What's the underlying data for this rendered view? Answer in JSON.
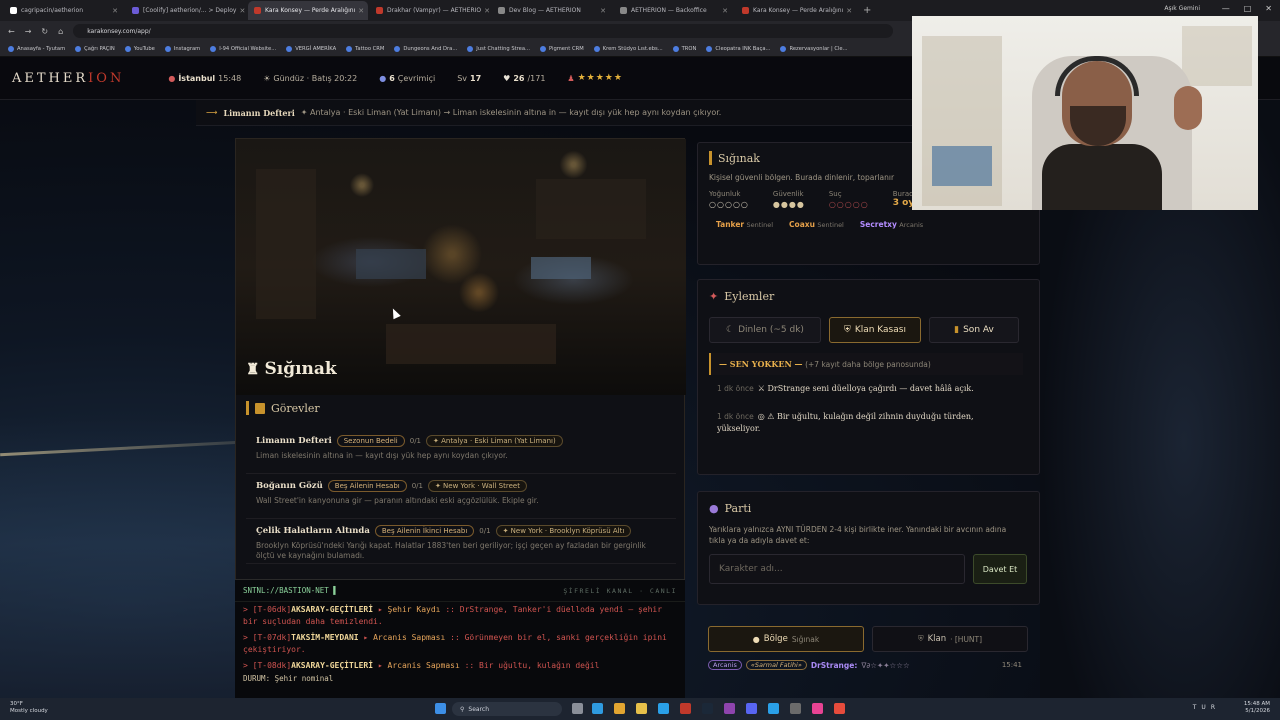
{
  "browser": {
    "tabs": [
      {
        "label": "cagripacin/aetherion",
        "color": "#ffffff",
        "active": false
      },
      {
        "label": "[Coolify] aetherion/... > Deploy",
        "color": "#6b5bd6",
        "active": false
      },
      {
        "label": "Kara Konsey — Perde Aralığını",
        "color": "#c0392b",
        "active": true
      },
      {
        "label": "Drakhar (Vampyr) — AETHERIO",
        "color": "#c0392b",
        "active": false
      },
      {
        "label": "Dev Blog — AETHERION",
        "color": "#888888",
        "active": false
      },
      {
        "label": "AETHERION — Backoffice",
        "color": "#888888",
        "active": false
      },
      {
        "label": "Kara Konsey — Perde Aralığını",
        "color": "#c0392b",
        "active": false
      }
    ],
    "profile": "Aşık Gemini",
    "url": "karakonsey.com/app/",
    "bookmarks": [
      "Anasayfa - Tyutam",
      "Çağrı PAÇIN",
      "YouTube",
      "Instagram",
      "I-94 Official Website...",
      "VERGİ AMERİKA",
      "Tattoo CRM",
      "Dungeons And Dra...",
      "Just Chatting Strea...",
      "Pigment CRM",
      "Krem Stüdyo Lıst.ebs...",
      "TRON",
      "Cleopatra INK Baça...",
      "Rezervasyonlar | Cle..."
    ]
  },
  "nav": {
    "logo_a": "AETHER",
    "logo_b": "ION",
    "city": "İstanbul",
    "time": "15:48",
    "daytime": "Gündüz · Batış 20:22",
    "online_count": "6",
    "online_label": "Çevrimiçi",
    "level_label": "Sv",
    "level": "17",
    "hp": "26",
    "hp_max": "/171",
    "stars": "★★★★★"
  },
  "questbar": {
    "title": "Limanın Defteri",
    "text": "✦ Antalya · Eski Liman (Yat Limanı) → Liman iskelesinin altına in — kayıt dışı yük hep aynı koydan çıkıyor."
  },
  "scene": {
    "title": "Sığınak"
  },
  "quests": {
    "title": "Görevler",
    "items": [
      {
        "name": "Limanın Defteri",
        "pill": "Sezonun Bedeli",
        "count": "0/1",
        "loc": "✦ Antalya · Eski Liman (Yat Limanı)",
        "desc": "Liman iskelesinin altına in — kayıt dışı yük hep aynı koydan çıkıyor."
      },
      {
        "name": "Boğanın Gözü",
        "pill": "Beş Ailenin Hesabı",
        "count": "0/1",
        "loc": "✦ New York · Wall Street",
        "desc": "Wall Street'in kanyonuna gir — paranın altındaki eski açgözlülük. Ekiple gir."
      },
      {
        "name": "Çelik Halatların Altında",
        "pill": "Beş Ailenin İkinci Hesabı",
        "count": "0/1",
        "loc": "✦ New York · Brooklyn Köprüsü Altı",
        "desc": "Brooklyn Köprüsü'ndeki Yarığı kapat. Halatlar 1883'ten beri geriliyor; işçi geçen ay fazladan bir gerginlik ölçtü ve kaynağını bulamadı."
      }
    ]
  },
  "terminal": {
    "title": "SNTNL://BASTION-NET ▌",
    "tag": "ŞİFRELİ KANAL · CANLI",
    "lines": [
      {
        "time": "> [T-06dk]",
        "place": "AKSARAY-GEÇİTLERİ",
        "arrow": " ▸ ",
        "kind": "Şehir Kaydı",
        "text": " :: DrStrange, Tanker'i düelloda yendi — şehir bir suçludan daha temizlendi."
      },
      {
        "time": "> [T-07dk]",
        "place": "TAKSİM-MEYDANI",
        "arrow": " ▸ ",
        "kind": "Arcanis Sapması",
        "text": " :: Görünmeyen bir el, sanki gerçekliğin ipini çekiştiriyor."
      },
      {
        "time": "> [T-08dk]",
        "place": "AKSARAY-GEÇİTLERİ",
        "arrow": " ▸ ",
        "kind": "Arcanis Sapması",
        "text": " :: Bir uğultu, kulağın değil"
      }
    ],
    "status": "DURUM: Şehir nominal"
  },
  "sanctuary": {
    "title": "Sığınak",
    "desc": "Kişisel güvenli bölgen. Burada dinlenir, toparlanır",
    "stats": [
      {
        "label": "Yoğunluk",
        "value": "○○○○○"
      },
      {
        "label": "Güvenlik",
        "value": "●●●●"
      },
      {
        "label": "Suç",
        "value": "○○○○○"
      },
      {
        "label": "Burada",
        "value": "3 oyuncu"
      }
    ],
    "players": [
      {
        "name": "Tanker",
        "role": "Sentinel"
      },
      {
        "name": "Coaxu",
        "role": "Sentinel"
      },
      {
        "name": "Secretxy",
        "role": "Arcanis"
      }
    ]
  },
  "actions": {
    "title": "Eylemler",
    "rest": "Dinlen (~5 dk)",
    "vault": "Klan Kasası",
    "hunt": "Son Av",
    "feed_head": "— SEN YOKKEN —",
    "feed_more": "(+7 kayıt daha bölge panosunda)",
    "feed": [
      {
        "time": "1 dk önce",
        "text": "⚔ DrStrange seni düelloya çağırdı — davet hâlâ açık."
      },
      {
        "time": "1 dk önce",
        "text": "◎ ⚠ Bir uğultu, kulağın değil zihnin duyduğu türden, yükseliyor."
      }
    ]
  },
  "party": {
    "title": "Parti",
    "desc": "Yarıklara yalnızca AYNI TÜRDEN 2-4 kişi birlikte iner. Yanındaki bir avcının adına tıkla ya da adıyla davet et:",
    "placeholder": "Karakter adı...",
    "invite": "Davet Et"
  },
  "chat": {
    "tab1": "Bölge",
    "tab1_sub": "Sığınak",
    "tab2": "Klan",
    "tab2_sub": "· [HUNT]",
    "badge1": "Arcanis",
    "badge2": "«Sarmal Fatihi»",
    "sender": "DrStrange:",
    "glyphs": "∇∂☆✦✦☆☆☆",
    "time": "15:41"
  },
  "taskbar": {
    "temp": "30°F",
    "weather": "Mostly cloudy",
    "search": "Search",
    "lang": "TUR",
    "time": "15:48 AM",
    "date": "5/1/2026"
  }
}
